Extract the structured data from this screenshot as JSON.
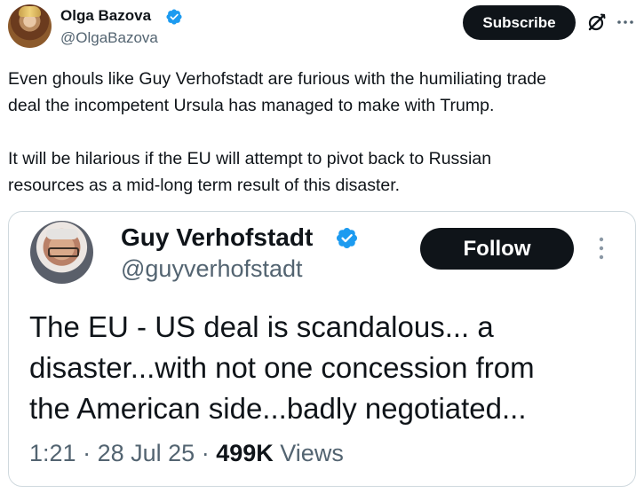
{
  "post": {
    "author_name": "Olga Bazova",
    "author_handle": "@OlgaBazova",
    "subscribe_label": "Subscribe",
    "text_paragraphs": [
      "Even ghouls like Guy Verhofstadt are furious with the humiliating trade\ndeal the incompetent Ursula has managed to make with Trump.",
      "It will be hilarious if the EU will attempt to pivot back to Russian\nresources as a mid-long term result of this disaster."
    ]
  },
  "quote": {
    "author_name": "Guy Verhofstadt",
    "author_handle": "@guyverhofstadt",
    "follow_label": "Follow",
    "text": "The EU - US deal is scandalous... a\ndisaster...with not one concession from\nthe American side...badly negotiated...",
    "time": "1:21",
    "date": "28 Jul 25",
    "views_count": "499K",
    "views_label": "Views",
    "separator": "·"
  },
  "icons": {
    "verified": "verified-badge-icon",
    "grok": "grok-icon",
    "more": "more-icon"
  },
  "colors": {
    "verified_blue": "#1d9bf0",
    "text_primary": "#0f1419",
    "text_secondary": "#536471",
    "button_dark": "#0f1419",
    "border": "#cfd9de"
  }
}
